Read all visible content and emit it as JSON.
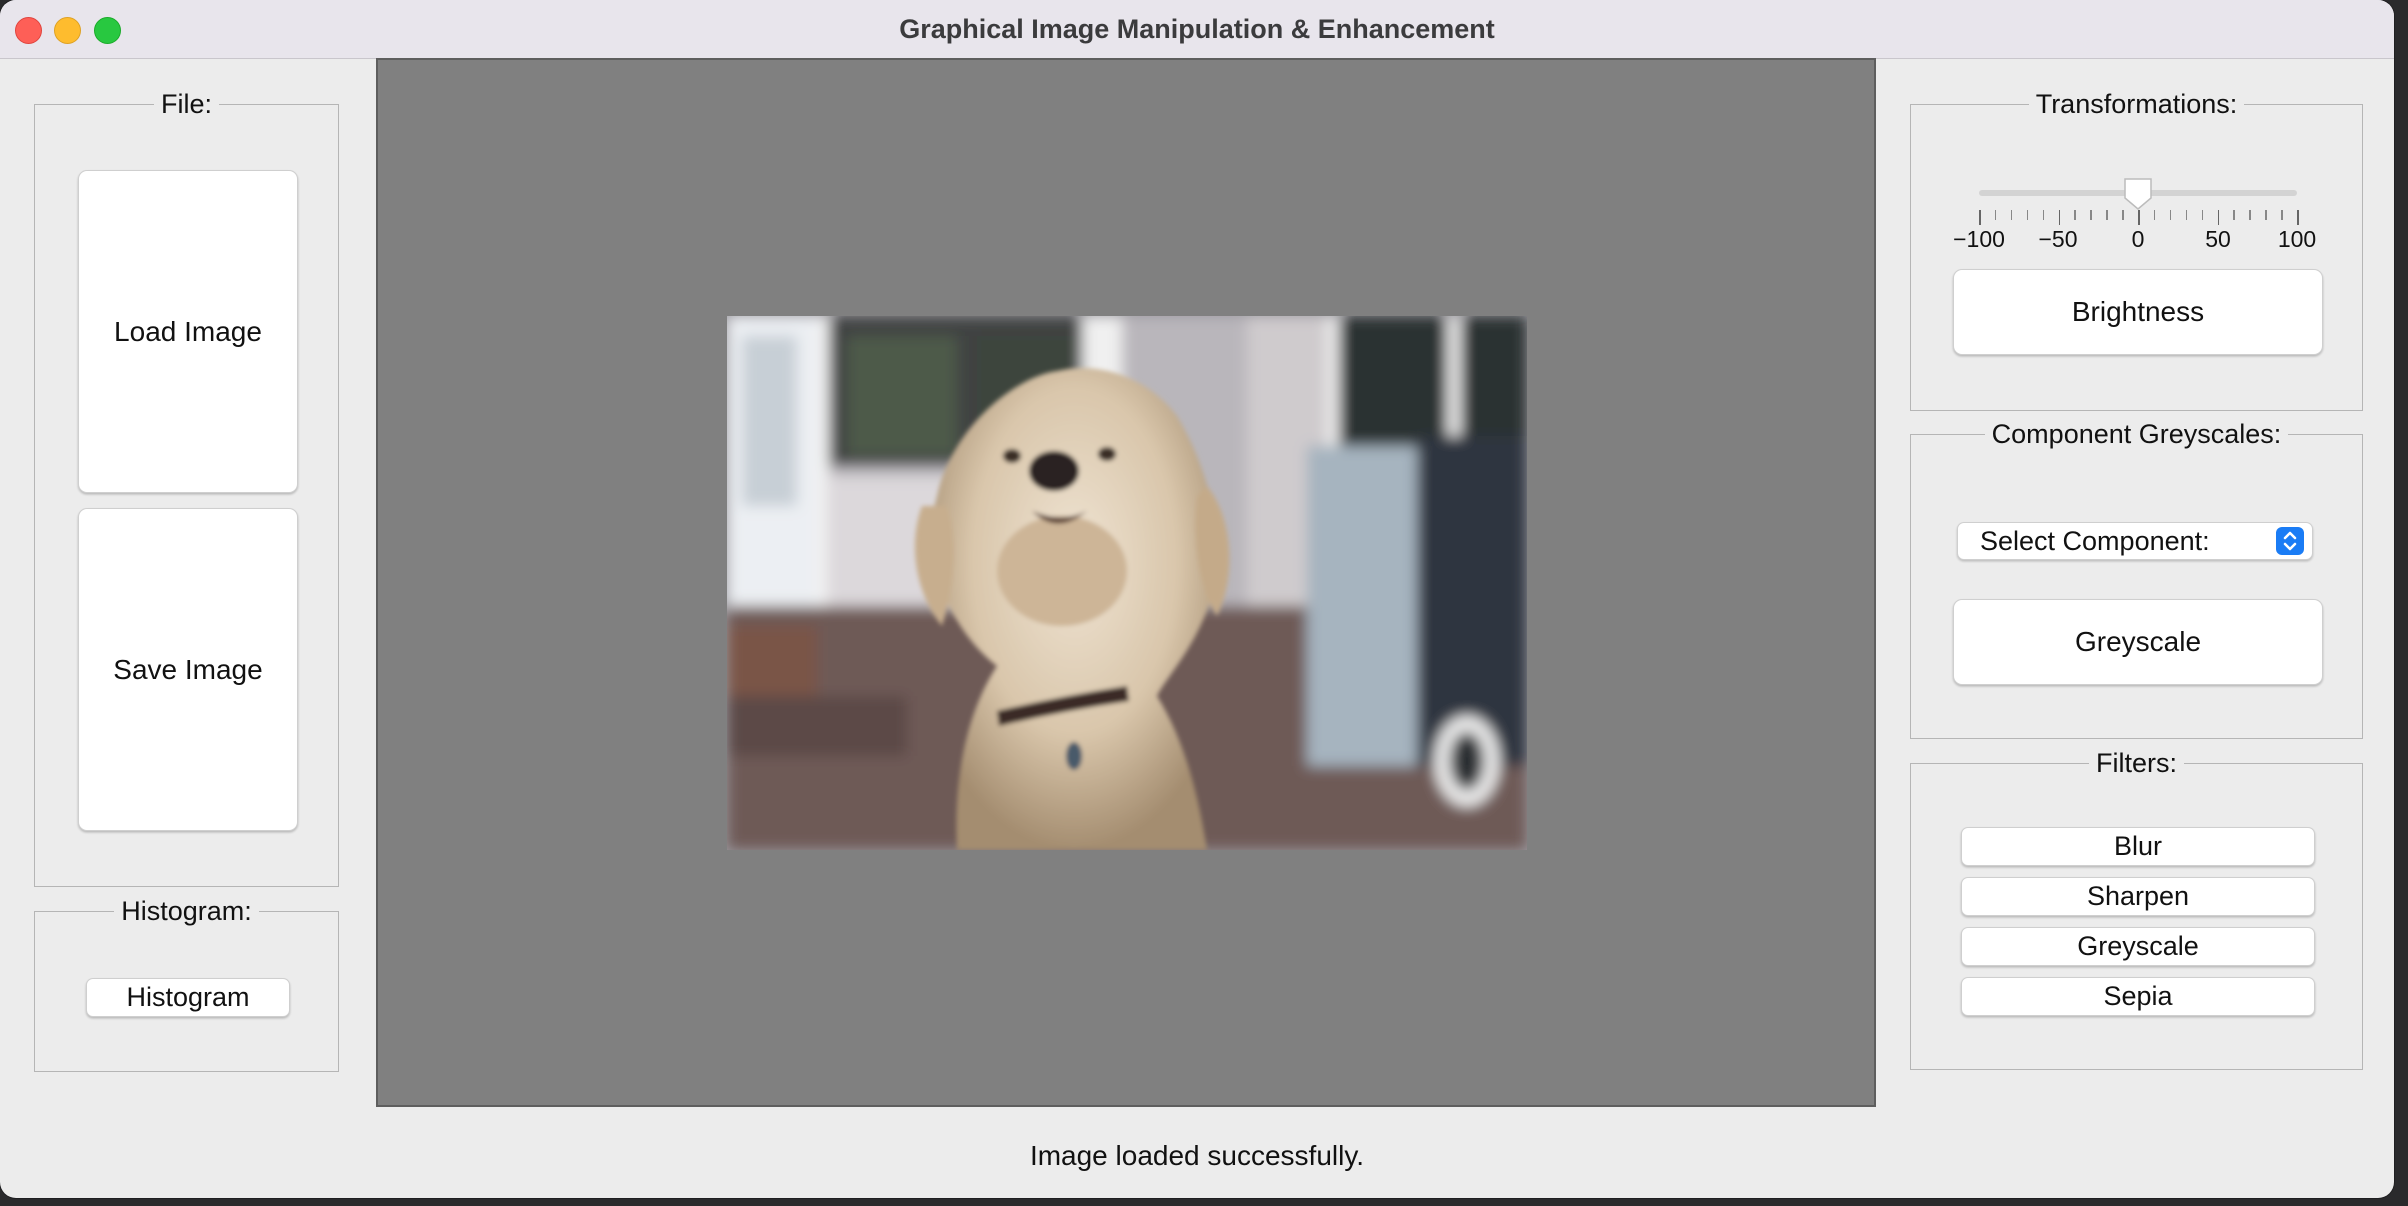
{
  "window": {
    "title": "Graphical Image Manipulation & Enhancement"
  },
  "file_panel": {
    "legend": "File:",
    "load_label": "Load Image",
    "save_label": "Save Image"
  },
  "histogram_panel": {
    "legend": "Histogram:",
    "button_label": "Histogram"
  },
  "transform_panel": {
    "legend": "Transformations:",
    "slider": {
      "min": -100,
      "max": 100,
      "value": 0,
      "tick_labels": [
        "−100",
        "−50",
        "0",
        "50",
        "100"
      ]
    },
    "brightness_label": "Brightness"
  },
  "component_panel": {
    "legend": "Component Greyscales:",
    "select_value": "Select Component:",
    "greyscale_label": "Greyscale"
  },
  "filters_panel": {
    "legend": "Filters:",
    "items": [
      "Blur",
      "Sharpen",
      "Greyscale",
      "Sepia"
    ]
  },
  "status": {
    "text": "Image loaded successfully."
  },
  "colors": {
    "canvas_bg": "#808080",
    "close": "#fe5f57",
    "minimize": "#febc2e",
    "maximize": "#28c840",
    "select_accent": "#1a7cf5"
  },
  "icons": [
    "close-icon",
    "minimize-icon",
    "maximize-icon",
    "updown-chevron-icon",
    "slider-thumb"
  ]
}
